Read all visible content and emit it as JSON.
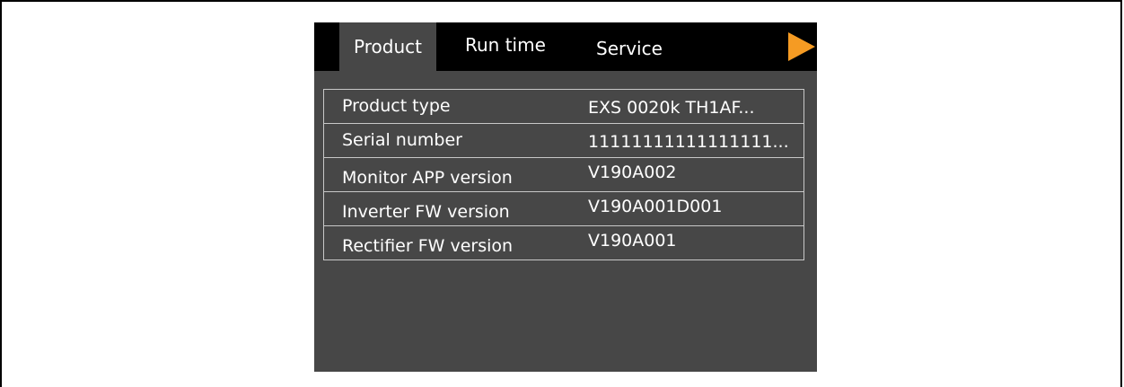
{
  "tabs": [
    {
      "label": "Product",
      "active": true
    },
    {
      "label": "Run time",
      "active": false
    },
    {
      "label": "Service",
      "active": false
    }
  ],
  "next_icon": "play-arrow-icon",
  "colors": {
    "screen_background": "#474747",
    "tab_bar": "#000000",
    "accent_arrow": "#f59b23",
    "text": "#ffffff",
    "grid_lines": "#c8c8c8"
  },
  "product_info": [
    {
      "label": "Product type",
      "value": "EXS 0020k TH1AF..."
    },
    {
      "label": "Serial number",
      "value": "11111111111111111..."
    },
    {
      "label": "Monitor APP version",
      "value": "V190A002"
    },
    {
      "label": "Inverter FW version",
      "value": "V190A001D001"
    },
    {
      "label": "Rectifier FW version",
      "value": "V190A001"
    }
  ]
}
